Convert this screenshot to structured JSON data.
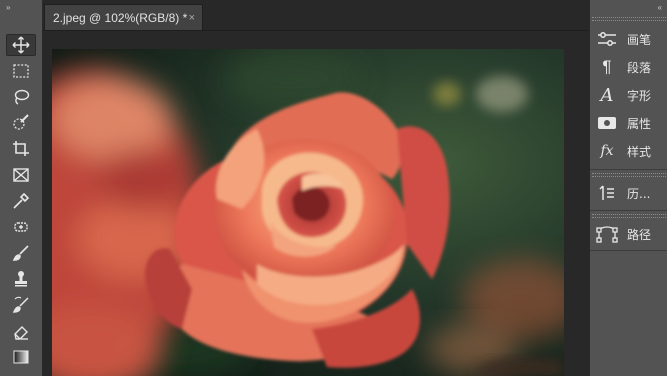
{
  "toolbar": {
    "collapse_glyph": "»",
    "tools": [
      {
        "name": "move-tool",
        "icon": "move-icon",
        "active": true
      },
      {
        "name": "rectangular-marquee-tool",
        "icon": "marquee-icon"
      },
      {
        "name": "lasso-tool",
        "icon": "lasso-icon"
      },
      {
        "name": "quick-selection-tool",
        "icon": "quick-selection-icon"
      },
      {
        "name": "crop-tool",
        "icon": "crop-icon"
      },
      {
        "name": "frame-tool",
        "icon": "frame-icon"
      },
      {
        "name": "eyedropper-tool",
        "icon": "eyedropper-icon"
      },
      {
        "name": "healing-brush-tool",
        "icon": "healing-brush-icon"
      },
      {
        "name": "brush-tool",
        "icon": "brush-icon"
      },
      {
        "name": "clone-stamp-tool",
        "icon": "stamp-icon"
      },
      {
        "name": "history-brush-tool",
        "icon": "history-brush-icon"
      },
      {
        "name": "eraser-tool",
        "icon": "eraser-icon"
      },
      {
        "name": "gradient-tool",
        "icon": "gradient-icon"
      }
    ]
  },
  "document": {
    "tab_title": "2.jpeg @ 102%(RGB/8) *",
    "close_glyph": "×"
  },
  "right_dock": {
    "collapse_glyph": "«",
    "panels": [
      {
        "label": "画笔",
        "icon": "brush-settings-icon"
      },
      {
        "label": "段落",
        "icon": "paragraph-icon"
      },
      {
        "label": "字形",
        "icon": "glyphs-icon"
      },
      {
        "label": "属性",
        "icon": "properties-icon"
      },
      {
        "label": "样式",
        "icon": "styles-fx-icon"
      },
      {
        "label": "历...",
        "icon": "history-icon"
      },
      {
        "label": "路径",
        "icon": "paths-icon"
      }
    ]
  },
  "colors": {
    "app_bg": "#282828",
    "panel_bg": "#535353",
    "tab_bg": "#424242",
    "rose_petal": "#e8604a",
    "rose_highlight": "#f2a37a",
    "leaf_green": "#2c4a30"
  }
}
